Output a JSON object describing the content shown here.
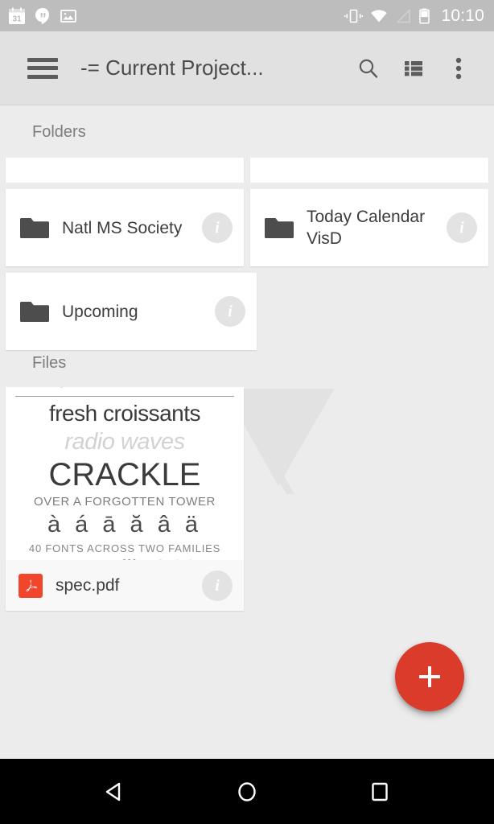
{
  "status_bar": {
    "left_icons": [
      {
        "name": "calendar-icon",
        "label": "31"
      },
      {
        "name": "hangouts-icon",
        "label": "Hangouts"
      },
      {
        "name": "photo-icon",
        "label": "Image"
      }
    ],
    "right_icons": [
      {
        "name": "vibrate-icon",
        "label": "Vibrate"
      },
      {
        "name": "wifi-icon",
        "label": "Wi-Fi"
      },
      {
        "name": "cellular-signal-icon",
        "label": "No signal"
      },
      {
        "name": "battery-icon",
        "label": "Battery"
      }
    ],
    "time": "10:10",
    "background": "#bdbdbd",
    "foreground": "#ffffff"
  },
  "toolbar": {
    "menu_label": "Menu",
    "title": "-= Current Project...",
    "search_label": "Search",
    "view_toggle_label": "List view",
    "overflow_label": "More options",
    "background": "#e1e1e1",
    "text_color": "#4a4a4a"
  },
  "sections": {
    "folders_label": "Folders",
    "files_label": "Files"
  },
  "folders": [
    {
      "name": "Natl MS Society",
      "info_label": "Info",
      "partial": false
    },
    {
      "name": "Today Calendar VisD",
      "info_label": "Info",
      "partial": false
    },
    {
      "name": "Upcoming",
      "info_label": "Info",
      "partial": false
    }
  ],
  "files": [
    {
      "name": "spec.pdf",
      "type": "pdf",
      "info_label": "Info",
      "icon_color": "#f2462c",
      "thumbnail": {
        "line1": "MONTPELLIER",
        "line2": "fresh croissants",
        "line3": "radio waves",
        "line4": "CRACKLE",
        "line5": "OVER A FORGOTTEN TOWER",
        "line6": "à á ā ă â ä",
        "line7": "40 FONTS ACROSS TWO FAMILIES",
        "line8a": "montpellier",
        "line8bar": "|",
        "line8b": "vide"
      }
    }
  ],
  "fab": {
    "label": "+",
    "action": "Add",
    "color": "#db3b2b"
  },
  "nav_bar": {
    "back_label": "Back",
    "home_label": "Home",
    "recents_label": "Recent apps",
    "background": "#000000"
  },
  "colors": {
    "page_background": "#ececec",
    "card_background": "#ffffff",
    "file_card_background": "#f8f8f8",
    "section_text": "#7d7d7d",
    "folder_icon": "#4d4d4d",
    "info_circle": "#e3e3e3",
    "watermark": "#e3e3e3"
  }
}
